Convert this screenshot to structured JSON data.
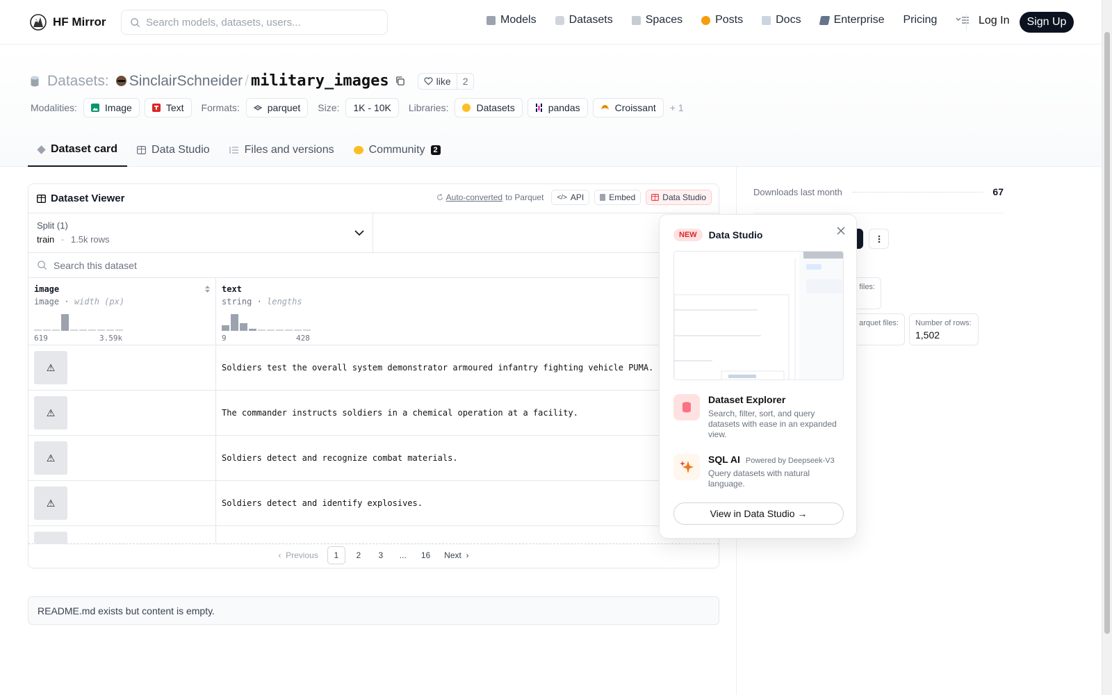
{
  "nav": {
    "brand": "HF Mirror",
    "search_placeholder": "Search models, datasets, users...",
    "links": [
      "Models",
      "Datasets",
      "Spaces",
      "Posts",
      "Docs",
      "Enterprise",
      "Pricing"
    ],
    "login": "Log In",
    "signup": "Sign Up"
  },
  "header": {
    "crumb": "Datasets:",
    "owner": "SinclairSchneider",
    "slash": "/",
    "repo": "military_images",
    "like_label": "like",
    "like_count": "2",
    "modalities_label": "Modalities:",
    "modalities": [
      "Image",
      "Text"
    ],
    "formats_label": "Formats:",
    "formats": [
      "parquet"
    ],
    "size_label": "Size:",
    "size": "1K - 10K",
    "libraries_label": "Libraries:",
    "libraries": [
      "Datasets",
      "pandas",
      "Croissant"
    ],
    "libraries_more": "+ 1"
  },
  "tabs": [
    {
      "label": "Dataset card"
    },
    {
      "label": "Data Studio"
    },
    {
      "label": "Files and versions"
    },
    {
      "label": "Community",
      "badge": "2"
    }
  ],
  "viewer": {
    "title": "Dataset Viewer",
    "auto_link": "Auto-converted",
    "auto_rest": "to Parquet",
    "api": "API",
    "embed": "Embed",
    "studio": "Data Studio",
    "split_label": "Split (1)",
    "split_name": "train",
    "split_dot": "·",
    "split_rows": "1.5k rows",
    "search_placeholder": "Search this dataset",
    "columns": [
      {
        "name": "image",
        "type": "image",
        "stat": "width (px)",
        "min": "619",
        "max": "3.59k",
        "hist": [
          0,
          0,
          0,
          24,
          0,
          0,
          0,
          0,
          0,
          0
        ]
      },
      {
        "name": "text",
        "type": "string",
        "stat": "lengths",
        "min": "9",
        "max": "428",
        "hist": [
          8,
          24,
          11,
          3,
          0,
          0,
          0,
          0,
          0,
          0
        ]
      }
    ],
    "rows": [
      "Soldiers test the overall system demonstrator armoured infantry fighting vehicle PUMA.",
      "The commander instructs soldiers in a chemical operation at a facility.",
      "Soldiers detect and recognize combat materials.",
      "Soldiers detect and identify explosives."
    ],
    "pager": {
      "prev": "Previous",
      "pages": [
        "1",
        "2",
        "3",
        "...",
        "16"
      ],
      "next": "Next"
    }
  },
  "readme_note": "README.md exists but content is empty.",
  "sidebar": {
    "downloads_label": "Downloads last month",
    "downloads_value": "67",
    "frag1": "files:",
    "frag2": "arquet files:",
    "rows_label": "Number of rows:",
    "rows_value": "1,502"
  },
  "popover": {
    "new": "NEW",
    "title": "Data Studio",
    "feature1_title": "Dataset Explorer",
    "feature1_desc": "Search, filter, sort, and query datasets with ease in an expanded view.",
    "feature2_title": "SQL AI",
    "feature2_sub": "Powered by Deepseek-V3",
    "feature2_desc": "Query datasets with natural language.",
    "cta": "View in Data Studio →"
  },
  "colors": {
    "accent_dark": "#0b1220",
    "new_red": "#dc2626"
  }
}
